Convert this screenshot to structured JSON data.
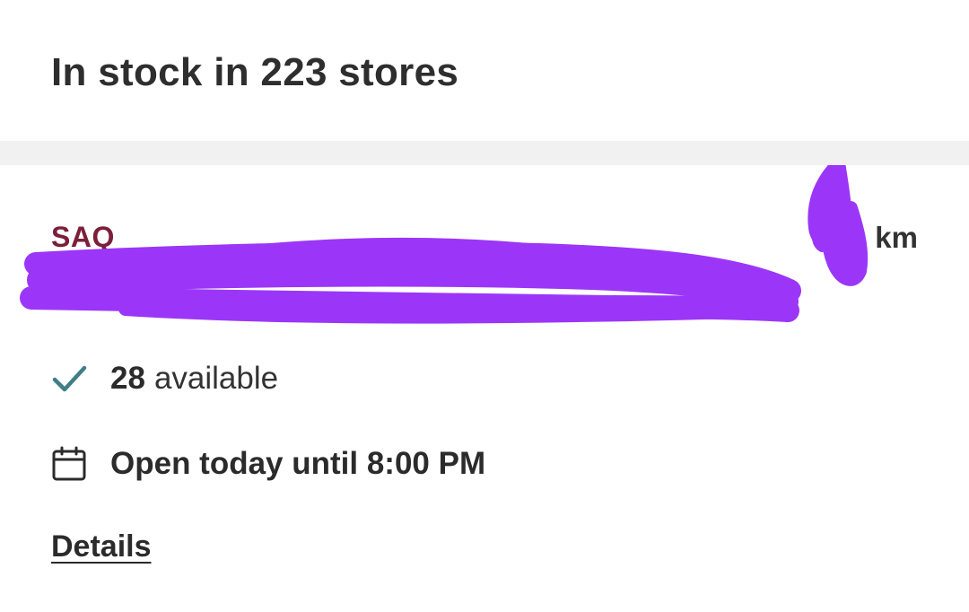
{
  "header": {
    "title": "In stock in 223 stores"
  },
  "store": {
    "brand": "SAQ",
    "distance_unit": "km",
    "availability": {
      "count": "28",
      "label": "available"
    },
    "hours": "Open today until 8:00 PM",
    "details_link": "Details"
  },
  "colors": {
    "brand": "#7b1f3b",
    "check": "#3f7f86",
    "scribble": "#9b36f8",
    "band": "#f1f1f1"
  },
  "icons": {
    "availability": "checkmark-icon",
    "hours": "calendar-icon"
  }
}
